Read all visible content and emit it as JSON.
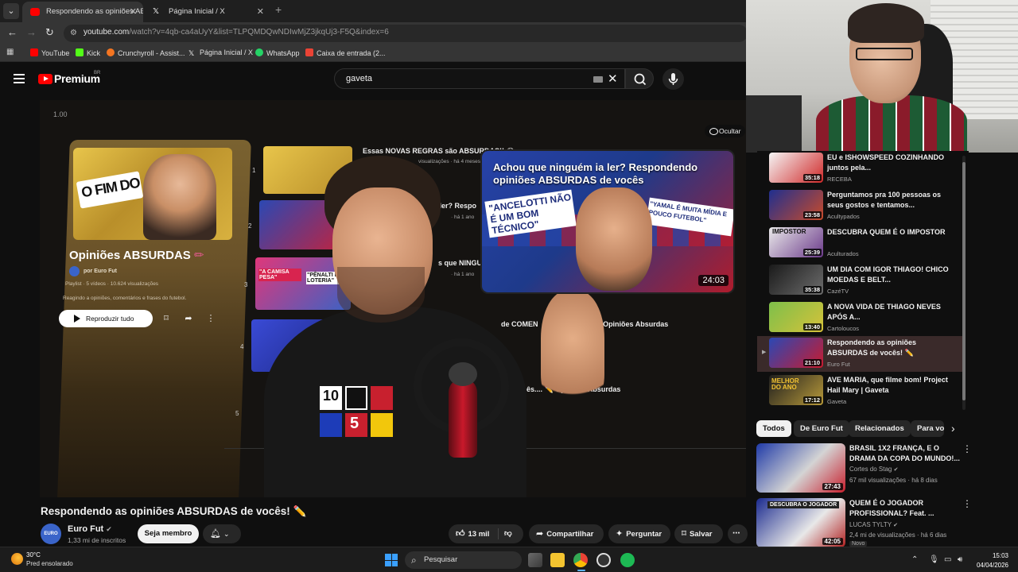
{
  "browser": {
    "tabs": [
      {
        "title": "Respondendo as opiniões ABSURDAS",
        "active": true
      },
      {
        "title": "Página Inicial / X",
        "active": false
      }
    ],
    "url_domain": "youtube.com",
    "url_rest": "/watch?v=4qb-ca4aUyY&list=TLPQMDQwNDIwMjZ3jkqUj3-F5Q&index=6",
    "bookmarks": [
      {
        "label": "YouTube",
        "color": "#ff0000"
      },
      {
        "label": "Kick",
        "color": "#53fc18"
      },
      {
        "label": "Crunchyroll - Assist...",
        "color": "#f47521"
      },
      {
        "label": "Página Inicial / X",
        "color": "#ffffff"
      },
      {
        "label": "WhatsApp",
        "color": "#25d366"
      },
      {
        "label": "Caixa de entrada (2...",
        "color": "#ea4335"
      }
    ]
  },
  "header": {
    "logo_text": "Premium",
    "logo_region": "BR",
    "search_query": "gaveta"
  },
  "player": {
    "speed": "1.00",
    "hide_label": "Ocultar",
    "playlist": {
      "thumb_text": "O FIM DO",
      "title": "Opiniões ABSURDAS",
      "by": "por Euro Fut",
      "meta": "Playlist · 5 vídeos · 10.624 visualizações",
      "description": "Reagindo a opiniões, comentários e frases do futebol.",
      "play_all": "Reproduzir tudo"
    },
    "rows": [
      {
        "num": "1",
        "title": "Essas NOVAS REGRAS são ABSURDAS!! 😂",
        "meta": "visualizações · há 4 meses"
      },
      {
        "num": "2",
        "title": "a ler? Respo",
        "meta": "· há 1 ano"
      },
      {
        "num": "3",
        "title": "s que NINGU",
        "meta": "· há 1 ano"
      },
      {
        "num": "4",
        "title": "de COMEN",
        "meta": ""
      },
      {
        "num": "5",
        "title": "ês.... ✏️ Opiniões Absurdas",
        "meta": ""
      }
    ],
    "row4_tail": "Opiniões Absurdas",
    "row3_thumb_text_1": "\"A CAMISA PESA\"",
    "row3_thumb_text_2": "\"PÊNALTI É LOTERIA\"",
    "preview": {
      "title": "Achou que ninguém ia ler? Respondendo opiniões ABSURDAS de vocês",
      "sign1": "\"ANCELOTTI NÃO É UM BOM TÉCNICO\"",
      "sign2": "\"YAMAL É MUITA MÍDIA E POUCO FUTEBOL\"",
      "duration": "24:03"
    },
    "jersey_digits": [
      "10",
      "5"
    ]
  },
  "video": {
    "title": "Respondendo as opiniões ABSURDAS de vocês! ✏️",
    "channel": "Euro Fut",
    "channel_avatar_text": "EURO FUT",
    "subscribers": "1,33 mi de inscritos",
    "join_label": "Seja membro",
    "likes": "13 mil",
    "share_label": "Compartilhar",
    "ask_label": "Perguntar",
    "save_label": "Salvar"
  },
  "sidebar_playlist": [
    {
      "title": "EU e ISHOWSPEED COZINHANDO juntos pela...",
      "channel": "RECEBA",
      "duration": "35:18",
      "active": false
    },
    {
      "title": "Perguntamos pra 100 pessoas os seus gostos e tentamos...",
      "channel": "Acultурados",
      "duration": "23:58",
      "active": false
    },
    {
      "title": "DESCUBRA QUEM É O IMPOSTOR",
      "channel": "Aculturados",
      "duration": "25:39",
      "active": false,
      "thumb_text": "IMPOSTOR"
    },
    {
      "title": "UM DIA COM IGOR THIAGO! CHICO MOEDAS E BELT...",
      "channel": "CazéTV",
      "duration": "35:38",
      "active": false
    },
    {
      "title": "A NOVA VIDA DE THIAGO NEVES APÓS A...",
      "channel": "Cartoloucos",
      "duration": "13:40",
      "active": false
    },
    {
      "title": "Respondendo as opiniões ABSURDAS de vocês! ✏️",
      "channel": "Euro Fut",
      "duration": "21:10",
      "active": true
    },
    {
      "title": "AVE MARIA, que filme bom! Project Hail Mary | Gaveta",
      "channel": "Gaveta",
      "duration": "17:12",
      "active": false,
      "thumb_text": "MELHOR DO ANO"
    }
  ],
  "chips": [
    "Todos",
    "De Euro Fut",
    "Relacionados",
    "Para vo"
  ],
  "recommendations": [
    {
      "title": "BRASIL 1X2 FRANÇA, E O DRAMA DA COPA DO MUNDO!...",
      "channel": "Cortes do Stag",
      "meta": "67 mil visualizações · há 8 dias",
      "duration": "27:43",
      "badge": ""
    },
    {
      "title": "QUEM É O JOGADOR PROFISSIONAL? Feat. ...",
      "channel": "LUCAS TYLTY",
      "meta": "2,4 mi de visualizações · há 6 dias",
      "duration": "42:05",
      "badge": "Novo",
      "thumb_text": "DESCUBRA O JOGADOR"
    }
  ],
  "taskbar": {
    "temp": "30°C",
    "weather": "Pred ensolarado",
    "search_placeholder": "Pesquisar",
    "time": "15:03",
    "date": "04/04/2026"
  },
  "colors": {
    "accent_red": "#ff0000",
    "bg": "#0f0f0f",
    "active_row": "#3a2a2a"
  }
}
